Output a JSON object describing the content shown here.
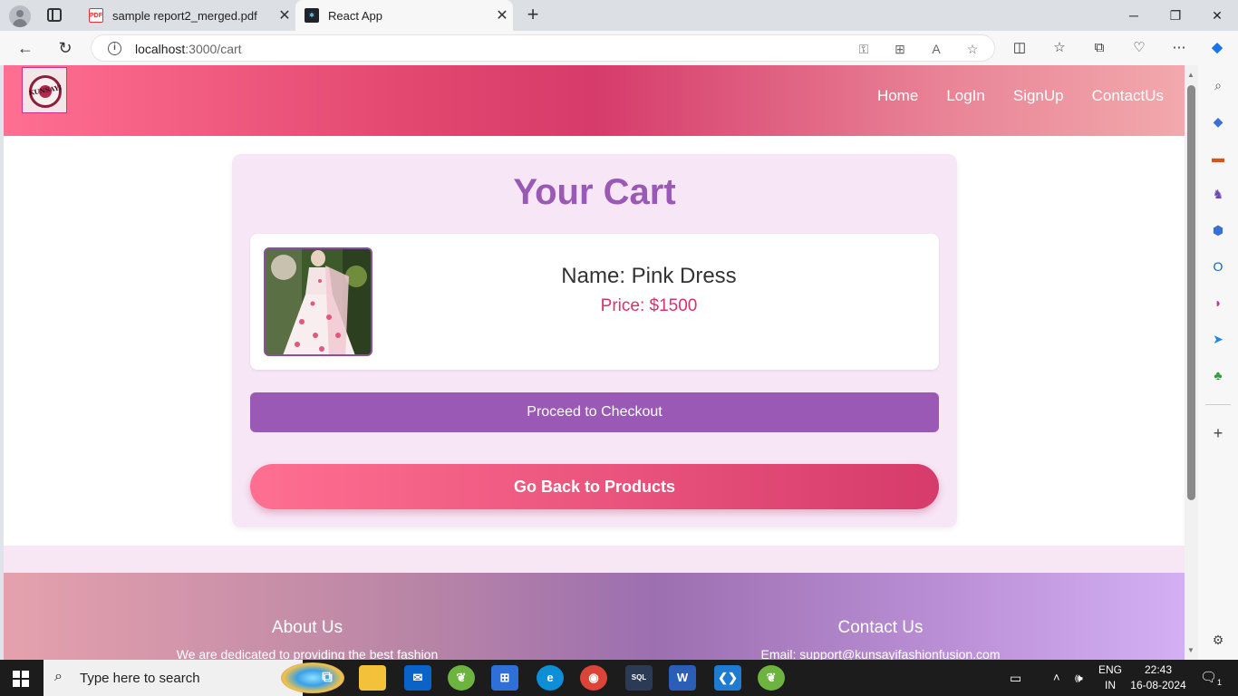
{
  "browser": {
    "tabs": [
      {
        "label": "sample report2_merged.pdf",
        "favicon": "pdf-icon"
      },
      {
        "label": "React App",
        "favicon": "react-icon"
      }
    ],
    "url_host": "localhost",
    "url_path": ":3000/cart"
  },
  "site": {
    "logo_text": "KUNSAYI",
    "nav": [
      "Home",
      "LogIn",
      "SignUp",
      "ContactUs"
    ]
  },
  "cart": {
    "title": "Your Cart",
    "item_name": "Name: Pink Dress",
    "item_price": "Price: $1500",
    "checkout_label": "Proceed to Checkout",
    "back_label": "Go Back to Products"
  },
  "footer": {
    "about_title": "About Us",
    "about_text": "We are dedicated to providing the best fashion",
    "contact_title": "Contact Us",
    "contact_text": "Email: support@kunsayifashionfusion.com"
  },
  "taskbar": {
    "search_placeholder": "Type here to search",
    "lang_top": "ENG",
    "lang_bottom": "IN",
    "time": "22:43",
    "date": "16-08-2024",
    "notification_count": "1"
  },
  "colors": {
    "accent_purple": "#9b59b6",
    "price_pink": "#d6336c",
    "header_pink": "#d63b6b"
  }
}
